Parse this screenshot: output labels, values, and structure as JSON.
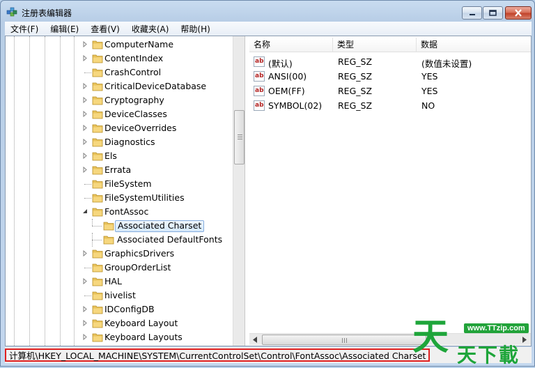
{
  "window": {
    "title": "注册表编辑器",
    "app_icon": "registry-editor-icon"
  },
  "menu": [
    "文件(F)",
    "编辑(E)",
    "查看(V)",
    "收藏夹(A)",
    "帮助(H)"
  ],
  "tree": {
    "items": [
      {
        "label": "ComputerName",
        "expandable": true
      },
      {
        "label": "ContentIndex",
        "expandable": true
      },
      {
        "label": "CrashControl",
        "expandable": false
      },
      {
        "label": "CriticalDeviceDatabase",
        "expandable": true
      },
      {
        "label": "Cryptography",
        "expandable": true
      },
      {
        "label": "DeviceClasses",
        "expandable": true
      },
      {
        "label": "DeviceOverrides",
        "expandable": true
      },
      {
        "label": "Diagnostics",
        "expandable": true
      },
      {
        "label": "Els",
        "expandable": true
      },
      {
        "label": "Errata",
        "expandable": true
      },
      {
        "label": "FileSystem",
        "expandable": false
      },
      {
        "label": "FileSystemUtilities",
        "expandable": false
      },
      {
        "label": "FontAssoc",
        "expandable": true,
        "expanded": true
      },
      {
        "label": "Associated Charset",
        "child": true,
        "selected": true
      },
      {
        "label": "Associated DefaultFonts",
        "child": true
      },
      {
        "label": "GraphicsDrivers",
        "expandable": true
      },
      {
        "label": "GroupOrderList",
        "expandable": false
      },
      {
        "label": "HAL",
        "expandable": true
      },
      {
        "label": "hivelist",
        "expandable": false
      },
      {
        "label": "IDConfigDB",
        "expandable": true
      },
      {
        "label": "Keyboard Layout",
        "expandable": true
      },
      {
        "label": "Keyboard Layouts",
        "expandable": true
      }
    ]
  },
  "values": {
    "headers": {
      "name": "名称",
      "type": "类型",
      "data": "数据"
    },
    "rows": [
      {
        "name": "(默认)",
        "type": "REG_SZ",
        "data": "(数值未设置)",
        "icon": "string-value-icon"
      },
      {
        "name": "ANSI(00)",
        "type": "REG_SZ",
        "data": "YES",
        "icon": "string-value-icon"
      },
      {
        "name": "OEM(FF)",
        "type": "REG_SZ",
        "data": "YES",
        "icon": "string-value-icon"
      },
      {
        "name": "SYMBOL(02)",
        "type": "REG_SZ",
        "data": "NO",
        "icon": "string-value-icon"
      }
    ],
    "icon_text": "ab"
  },
  "status": {
    "path": "计算机\\HKEY_LOCAL_MACHINE\\SYSTEM\\CurrentControlSet\\Control\\FontAssoc\\Associated Charset"
  },
  "watermark": {
    "url": "www.TTzip.com",
    "big": "天",
    "sub": "天下載"
  },
  "colors": {
    "selection_border": "#84acdd",
    "folder": "#e8c25a",
    "status_highlight": "#e02020",
    "watermark_green": "#1ea53a"
  }
}
